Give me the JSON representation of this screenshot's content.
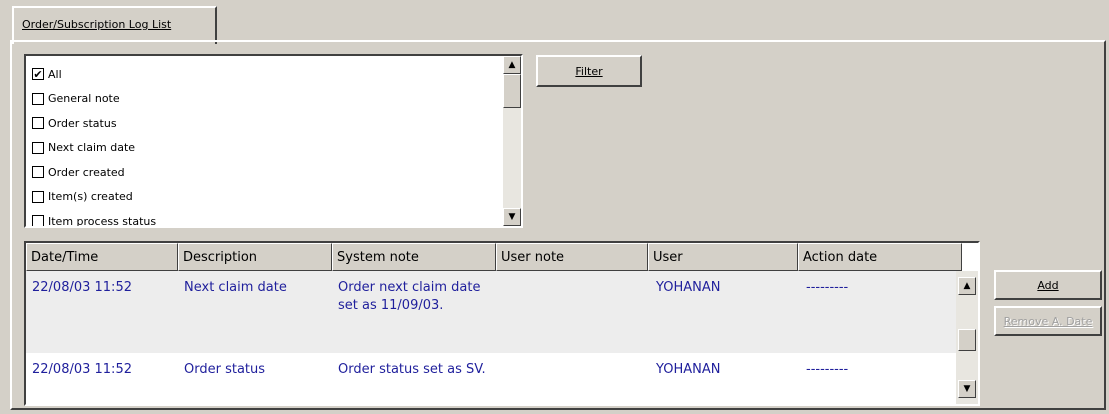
{
  "tab": {
    "label": "Order/Subscription Log List"
  },
  "filter_list": {
    "items": [
      {
        "label": "All",
        "checked": true
      },
      {
        "label": "General note",
        "checked": false
      },
      {
        "label": "Order status",
        "checked": false
      },
      {
        "label": "Next claim date",
        "checked": false
      },
      {
        "label": "Order created",
        "checked": false
      },
      {
        "label": "Item(s) created",
        "checked": false
      },
      {
        "label": "Item process status",
        "checked": false
      }
    ]
  },
  "buttons": {
    "filter": "Filter",
    "add": "Add",
    "remove_action_date": "Remove A. Date"
  },
  "grid": {
    "columns": [
      "Date/Time",
      "Description",
      "System note",
      "User note",
      "User",
      "Action date"
    ],
    "rows": [
      {
        "datetime": "22/08/03 11:52",
        "description": "Next claim date",
        "system_note": "Order next claim date set as 11/09/03.",
        "user_note": "",
        "user": "YOHANAN",
        "action_date": "---------"
      },
      {
        "datetime": "22/08/03 11:52",
        "description": "Order status",
        "system_note": "Order status set as SV.",
        "user_note": "",
        "user": "YOHANAN",
        "action_date": "---------"
      }
    ]
  },
  "colors": {
    "face": "#d4d0c8",
    "row_text": "#1f1f9c",
    "row_alt": "#ededed"
  }
}
